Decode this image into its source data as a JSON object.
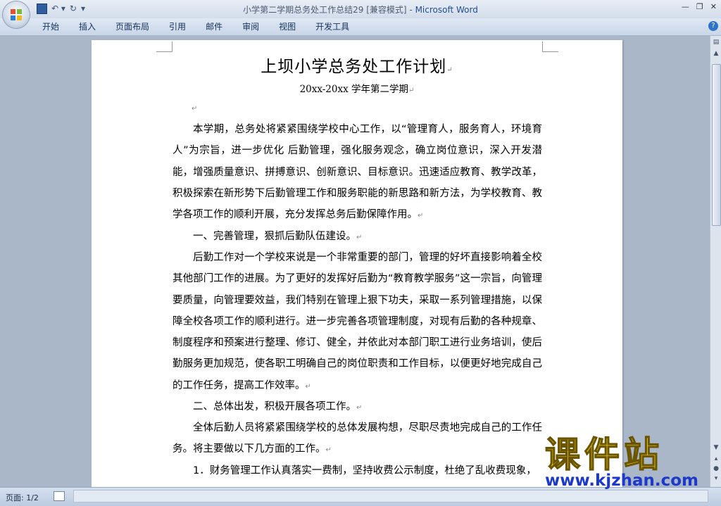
{
  "window": {
    "doc_name": "小学第二学期总务处工作总结29 [兼容模式]",
    "separator": " - ",
    "app_name": "Microsoft Word"
  },
  "ribbon": {
    "tabs": [
      "开始",
      "插入",
      "页面布局",
      "引用",
      "邮件",
      "审阅",
      "视图",
      "开发工具"
    ]
  },
  "document": {
    "title": "上坝小学总务处工作计划",
    "subtitle": "20xx-20xx 学年第二学期",
    "paragraphs": [
      "本学期，总务处将紧紧围绕学校中心工作，以“管理育人，服务育人，环境育人”为宗旨，进一步优化  后勤管理，强化服务观念，确立岗位意识，深入开发潜能，增强质量意识、拼搏意识、创新意识、目标意识。迅速适应教育、教学改革，积极探索在新形势下后勤管理工作和服务职能的新思路和新方法，为学校教育、教学各项工作的顺利开展，充分发挥总务后勤保障作用。",
      "一、完善管理，狠抓后勤队伍建设。",
      "后勤工作对一个学校来说是一个非常重要的部门，管理的好坏直接影响着全校其他部门工作的进展。为了更好的发挥好后勤为“教育教学服务”这一宗旨，向管理要质量，向管理要效益，我们特别在管理上狠下功夫，采取一系列管理措施，以保障全校各项工作的顺利进行。进一步完善各项管理制度，对现有后勤的各种规章、制度程序和预案进行整理、修订、健全，并依此对本部门职工进行业务培训，使后勤服务更加规范，使各职工明确自己的岗位职责和工作目标，以便更好地完成自己的工作任务，提高工作效率。",
      "二、总体出发，积极开展各项工作。",
      "全体后勤人员将紧紧围绕学校的总体发展构想，尽职尽责地完成自己的工作任务。将主要做以下几方面的工作。",
      "1．财务管理工作认真落实一费制，坚持收费公示制度，杜绝了乱收费现象，"
    ]
  },
  "statusbar": {
    "page": "页面: 1/2"
  },
  "watermark": {
    "brand": "课件站",
    "url": "www.kjzhan.com"
  }
}
